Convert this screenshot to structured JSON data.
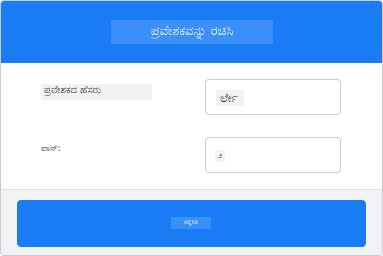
{
  "header": {
    "title": "ಪ್ರವೇಶಕವನ್ನು ರಚಿಸಿ"
  },
  "form": {
    "username_label": "ಪ್ರವೇಶಕದ ಹೆಸರು",
    "username_value": "ರ್ಲೇ",
    "password_label": "ಪಾಸ್:",
    "password_value": "೨"
  },
  "footer": {
    "submit_label": "ಸಲ್ಲಿಸಿರಿ"
  },
  "colors": {
    "primary": "#1a7cf5",
    "border": "#c9ccd3",
    "footer_bg": "#f2f3f5"
  }
}
